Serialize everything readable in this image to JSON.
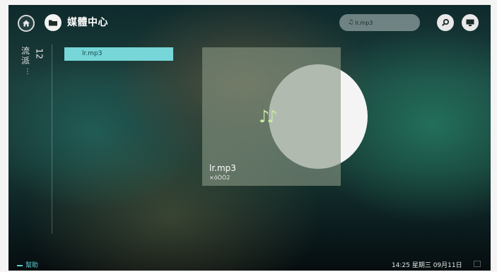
{
  "header": {
    "title": "媒體中心",
    "now_playing": {
      "icon": "music-notes-icon",
      "label": "lr.mp3"
    },
    "home_icon": "home-icon",
    "folder_icon": "folder-icon",
    "search_icon": "search-icon",
    "screen_icon": "tv-screen-icon"
  },
  "sidebar": {
    "genre": "流派",
    "count": "12",
    "more": "⋮"
  },
  "list": {
    "items": [
      {
        "label": "lr.mp3",
        "selected": true
      }
    ]
  },
  "album": {
    "title": "lr.mp3",
    "subtitle": "×óÒÒ2",
    "icon": "music-notes-icon"
  },
  "footer": {
    "help": "幫助",
    "time": "14:25",
    "day": "星期三",
    "date": "09月11日"
  },
  "colors": {
    "accent": "#76d6d8",
    "help": "#5fd0d6"
  }
}
